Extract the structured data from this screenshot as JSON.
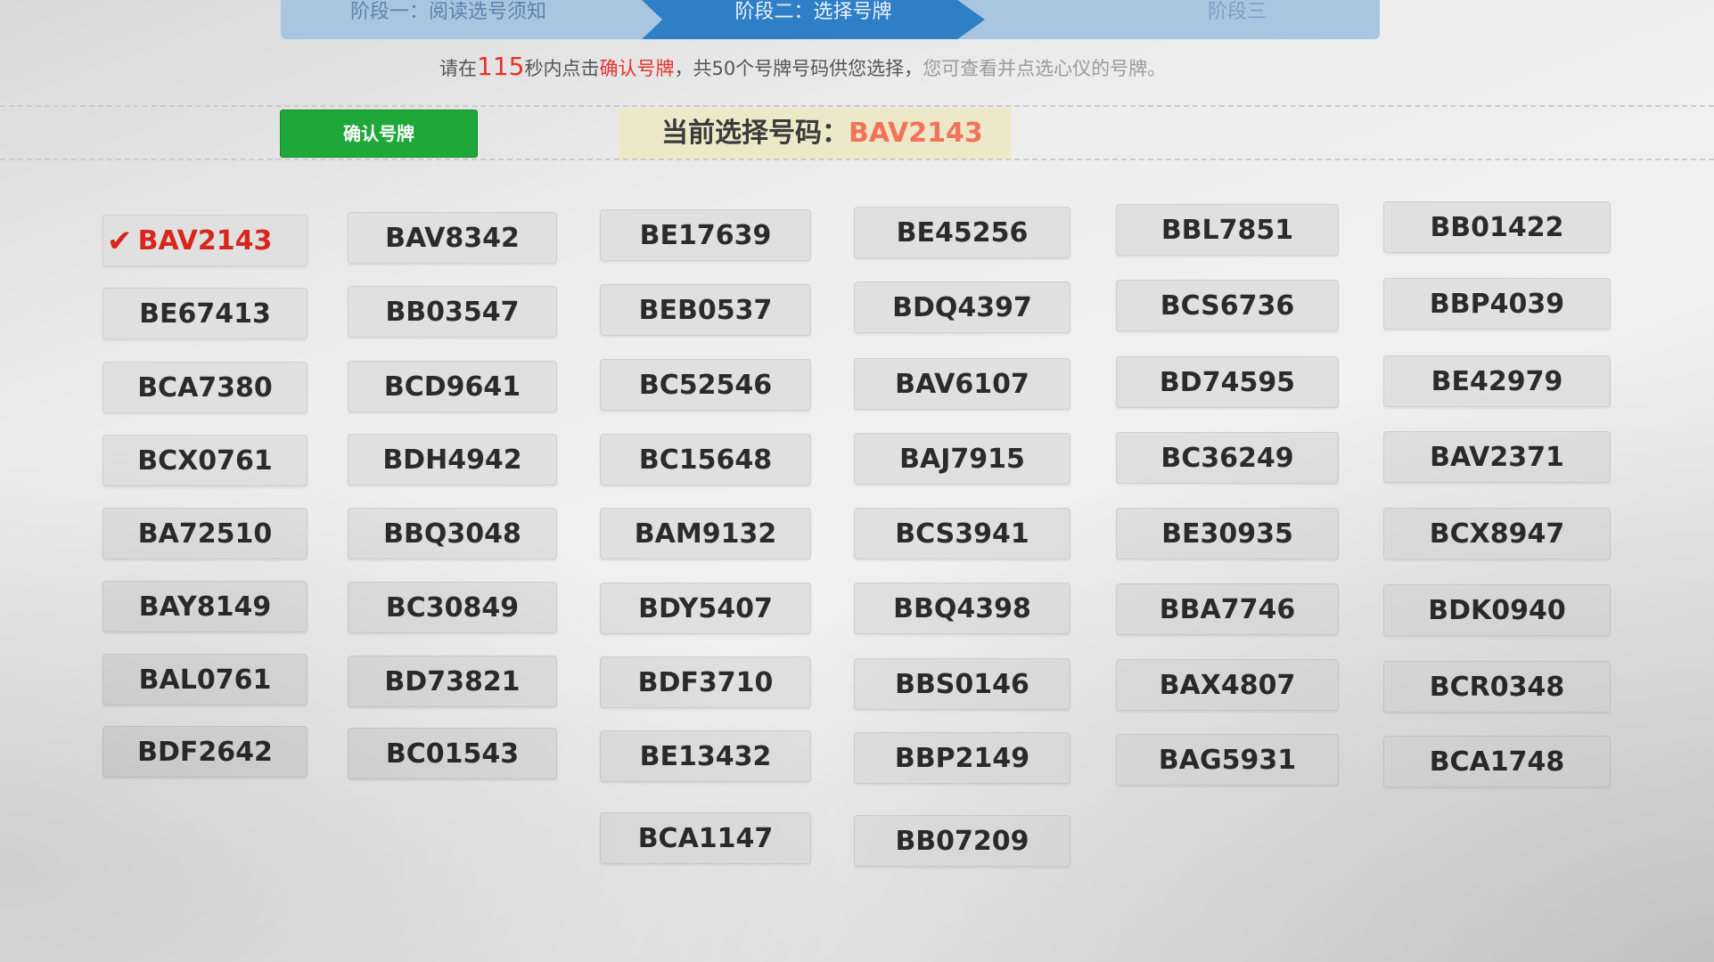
{
  "steps": [
    {
      "label": "阶段一：阅读选号须知"
    },
    {
      "label": "阶段二：选择号牌"
    },
    {
      "label": "阶段三"
    }
  ],
  "notice": {
    "prefix": "请在",
    "seconds": "115",
    "mid1": "秒内点击",
    "link": "确认号牌",
    "mid2": "，共50个号牌号码供您选择，",
    "suffix": "您可查看并点选心仪的号牌。"
  },
  "confirm_button": "确认号牌",
  "current": {
    "label": "当前选择号码：",
    "value": "BAV2143"
  },
  "selected_plate": "BAV2143",
  "plates": [
    [
      "BAV2143",
      "BAV8342",
      "BE17639",
      "BE45256",
      "BBL7851",
      "BB01422"
    ],
    [
      "BE67413",
      "BB03547",
      "BEB0537",
      "BDQ4397",
      "BCS6736",
      "BBP4039"
    ],
    [
      "BCA7380",
      "BCD9641",
      "BC52546",
      "BAV6107",
      "BD74595",
      "BE42979"
    ],
    [
      "BCX0761",
      "BDH4942",
      "BC15648",
      "BAJ7915",
      "BC36249",
      "BAV2371"
    ],
    [
      "BA72510",
      "BBQ3048",
      "BAM9132",
      "BCS3941",
      "BE30935",
      "BCX8947"
    ],
    [
      "BAY8149",
      "BC30849",
      "BDY5407",
      "BBQ4398",
      "BBA7746",
      "BDK0940"
    ],
    [
      "BAL0761",
      "BD73821",
      "BDF3710",
      "BBS0146",
      "BAX4807",
      "BCR0348"
    ],
    [
      "BDF2642",
      "BC01543",
      "BE13432",
      "BBP2149",
      "BAG5931",
      "BCA1748"
    ],
    [
      null,
      null,
      "BCA1147",
      "BB07209",
      null,
      null
    ]
  ]
}
